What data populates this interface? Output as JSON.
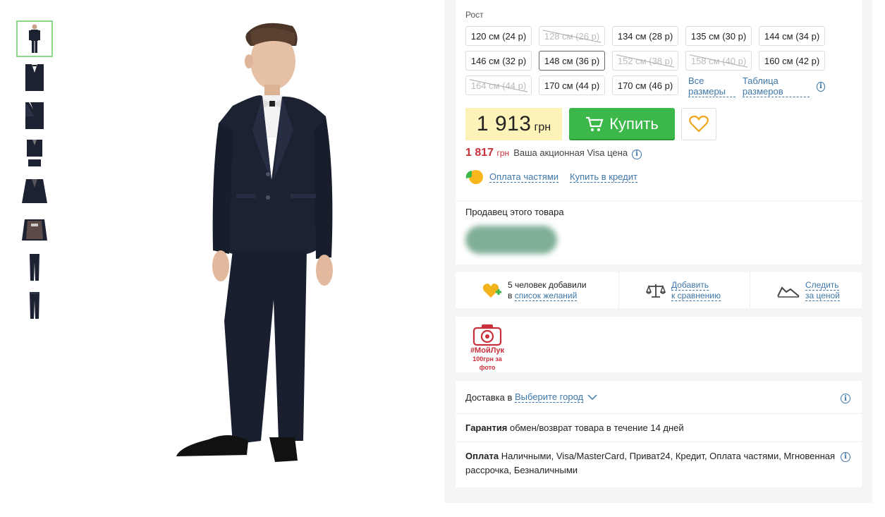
{
  "thumbnails": [
    "suit-front",
    "jacket-closeup",
    "jacket-detail",
    "suit-set",
    "jacket-flat",
    "jacket-lining",
    "trousers-front",
    "trousers-back"
  ],
  "sizes": {
    "label": "Рост",
    "items": [
      {
        "label": "120 см (24 р)",
        "state": "available"
      },
      {
        "label": "128 см (26 р)",
        "state": "disabled"
      },
      {
        "label": "134 см (28 р)",
        "state": "available"
      },
      {
        "label": "135 см (30 р)",
        "state": "available"
      },
      {
        "label": "144 см (34 р)",
        "state": "available"
      },
      {
        "label": "146 см (32 р)",
        "state": "available"
      },
      {
        "label": "148 см (36 р)",
        "state": "selected"
      },
      {
        "label": "152 см (38 р)",
        "state": "disabled"
      },
      {
        "label": "158 см (40 р)",
        "state": "disabled"
      },
      {
        "label": "160 см (42 р)",
        "state": "available"
      },
      {
        "label": "164 см (44 р)",
        "state": "disabled"
      },
      {
        "label": "170 см (44 р)",
        "state": "available"
      },
      {
        "label": "170 см (46 р)",
        "state": "available"
      }
    ],
    "all_sizes_link": "Все размеры",
    "size_table_link": "Таблица размеров"
  },
  "price": {
    "value": "1 913",
    "currency": "грн"
  },
  "buy_label": "Купить",
  "promo": {
    "price": "1 817",
    "currency": "грн",
    "text": "Ваша акционная Visa цена"
  },
  "credit": {
    "installments": "Оплата частями",
    "credit": "Купить в кредит"
  },
  "seller": {
    "title": "Продавец этого товара"
  },
  "actions": {
    "wishlist_line1": "5 человек добавили",
    "wishlist_prefix": "в",
    "wishlist_link": "список желаний",
    "compare_line1": "Добавить",
    "compare_line2": "к сравнению",
    "track_line1": "Следить",
    "track_line2": "за ценой"
  },
  "mylook": {
    "tag": "#МойЛук",
    "bonus": "100грн за фото"
  },
  "delivery": {
    "label": "Доставка в",
    "city": "Выберите город"
  },
  "guarantee": {
    "label": "Гарантия",
    "text": "обмен/возврат товара в течение 14 дней"
  },
  "payment": {
    "label": "Оплата",
    "text": "Наличными, Visa/MasterCard, Приват24, Кредит, Оплата частями, Мгновенная рассрочка, Безналичными"
  },
  "colors": {
    "accent": "#3bb849",
    "link": "#3e77aa",
    "price_bg": "#fdf3b8",
    "promo": "#c9303b",
    "suit": "#1d2233"
  }
}
